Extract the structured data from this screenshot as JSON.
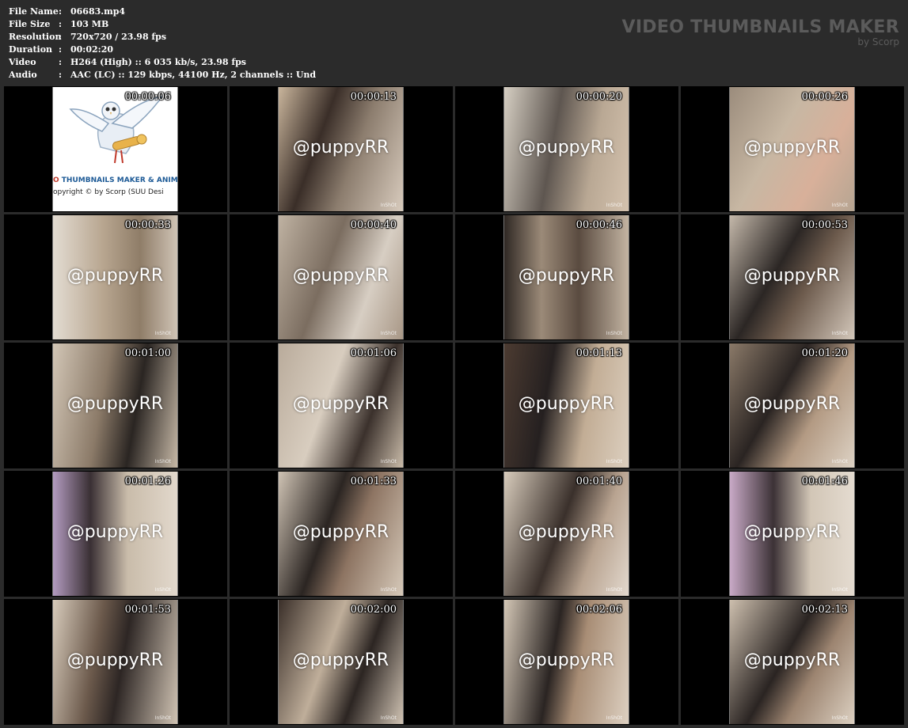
{
  "meta": [
    {
      "label": "File Name",
      "sep": ":",
      "value": "06683.mp4"
    },
    {
      "label": "File Size",
      "sep": ":",
      "value": "103 MB"
    },
    {
      "label": "Resolution",
      "sep": ":",
      "value": "720x720 / 23.98 fps"
    },
    {
      "label": "Duration",
      "sep": ":",
      "value": "00:02:20"
    },
    {
      "label": "Video",
      "sep": ":",
      "value": "H264 (High) :: 6 035 kb/s, 23.98 fps"
    },
    {
      "label": "Audio",
      "sep": ":",
      "value": "AAC (LC) :: 129 kbps, 44100 Hz, 2 channels :: Und"
    }
  ],
  "brand": {
    "title": "VIDEO THUMBNAILS MAKER",
    "subtitle": "by Scorp"
  },
  "logo": {
    "line1": "O THUMBNAILS MAKER & ANIM",
    "line2": "opyright © by Scorp (SUU Desi"
  },
  "watermark": "@puppyRR",
  "inshot": "InShOt",
  "colors": {
    "background": "#2b2b2b",
    "cell": "#000000",
    "brand_text": "#5b5b5b"
  },
  "thumbnails": [
    {
      "time": "00:00:06",
      "logo": true,
      "bg": "#ffffff"
    },
    {
      "time": "00:00:13",
      "bg": "linear-gradient(110deg,#c9b59c 0%,#3a2e28 35%,#8c7d6e 60%,#d8cbbd 100%)"
    },
    {
      "time": "00:00:20",
      "bg": "linear-gradient(100deg,#d6cfc3 0%,#5e5650 40%,#b9a894 70%,#d4c2ae 100%)"
    },
    {
      "time": "00:00:26",
      "bg": "linear-gradient(120deg,#9b8c7c 0%,#c7b7a3 40%,#d8b09a 70%,#b6a592 100%)"
    },
    {
      "time": "00:00:33",
      "bg": "linear-gradient(90deg,#e3dcd2 0%,#b8a690 40%,#8f7d68 70%,#cfc3b5 100%)"
    },
    {
      "time": "00:00:40",
      "bg": "linear-gradient(110deg,#bfb2a2 0%,#7b6d60 40%,#d7cec3 70%,#a89786 100%)"
    },
    {
      "time": "00:00:46",
      "bg": "linear-gradient(90deg,#2f2824 0%,#9b8a78 30%,#5a4b40 60%,#c3b4a2 100%)"
    },
    {
      "time": "00:00:53",
      "bg": "linear-gradient(120deg,#c4b8aa 0%,#2b2624 40%,#6c5a4c 60%,#d3c7ba 100%)"
    },
    {
      "time": "00:01:00",
      "bg": "linear-gradient(100deg,#d2c6b6 0%,#8b7a68 40%,#2a2522 65%,#c6b8a6 100%)"
    },
    {
      "time": "00:01:06",
      "bg": "linear-gradient(110deg,#b9ab9b 0%,#d8cdbf 40%,#3b312c 70%,#c9bba9 100%)"
    },
    {
      "time": "00:01:13",
      "bg": "linear-gradient(100deg,#4c3b31 0%,#252020 35%,#c2ad95 65%,#dccfbf 100%)"
    },
    {
      "time": "00:01:20",
      "bg": "linear-gradient(120deg,#8a7968 0%,#2a2422 40%,#b39a83 65%,#ddd2c4 100%)"
    },
    {
      "time": "00:01:26",
      "bg": "linear-gradient(90deg,#b39bc0 0%,#3a3034 30%,#c9bcaa 60%,#e2d8cc 100%)"
    },
    {
      "time": "00:01:33",
      "bg": "linear-gradient(110deg,#cfc3b4 0%,#2b2522 40%,#8d7462 60%,#d6c9b9 100%)"
    },
    {
      "time": "00:01:40",
      "bg": "linear-gradient(110deg,#d8ccbc 0%,#3a302b 45%,#b8a390 70%,#e3d9ce 100%)"
    },
    {
      "time": "00:01:46",
      "bg": "linear-gradient(90deg,#c8a9c6 0%,#3c3236 35%,#d2c6b6 65%,#e4dbd0 100%)"
    },
    {
      "time": "00:01:53",
      "bg": "linear-gradient(100deg,#d7cbbb 0%,#6c5a4c 35%,#2d2624 55%,#d0c3b3 100%)"
    },
    {
      "time": "00:02:00",
      "bg": "linear-gradient(110deg,#3a2f29 0%,#bfae9a 40%,#2c2522 65%,#d1c4b4 100%)"
    },
    {
      "time": "00:02:06",
      "bg": "linear-gradient(100deg,#d4c7b6 0%,#2a2422 40%,#a88d75 60%,#ddd0c1 100%)"
    },
    {
      "time": "00:02:13",
      "bg": "linear-gradient(120deg,#cdbfae 0%,#2a2422 45%,#9c8470 65%,#dcd0c1 100%)"
    }
  ]
}
